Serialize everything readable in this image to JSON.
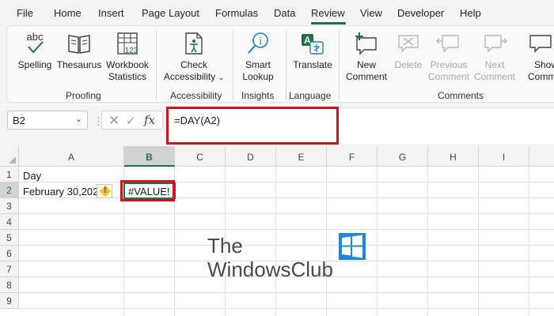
{
  "menu": {
    "tabs": [
      "File",
      "Home",
      "Insert",
      "Page Layout",
      "Formulas",
      "Data",
      "Review",
      "View",
      "Developer",
      "Help"
    ],
    "active_tab": "Review"
  },
  "ribbon": {
    "proofing": {
      "label": "Proofing",
      "spelling_icon_text": "abc",
      "spelling": "Spelling",
      "thesaurus": "Thesaurus",
      "workbook_stats_line1": "Workbook",
      "workbook_stats_line2": "Statistics",
      "stats_icon_text": "123"
    },
    "accessibility": {
      "label": "Accessibility",
      "check_line1": "Check",
      "check_line2": "Accessibility"
    },
    "insights": {
      "label": "Insights",
      "smart_line1": "Smart",
      "smart_line2": "Lookup"
    },
    "language": {
      "label": "Language",
      "translate": "Translate"
    },
    "comments": {
      "label": "Comments",
      "new_line1": "New",
      "new_line2": "Comment",
      "delete": "Delete",
      "previous_line1": "Previous",
      "previous_line2": "Comment",
      "next_line1": "Next",
      "next_line2": "Comment",
      "show_line1": "Show",
      "show_line2": "Comme"
    }
  },
  "formula_bar": {
    "name_box": "B2",
    "formula": "=DAY(A2)"
  },
  "sheet": {
    "columns": [
      "A",
      "B",
      "C",
      "D",
      "E",
      "F",
      "G",
      "H",
      "I"
    ],
    "selected_column": "B",
    "rows": [
      "1",
      "2",
      "3",
      "4",
      "5",
      "6",
      "7",
      "8",
      "9"
    ],
    "selected_row": "2",
    "cells": {
      "A1": "Day",
      "A2": "February 30,202",
      "B2": "#VALUE!"
    }
  },
  "watermark": {
    "line1": "The",
    "line2": "WindowsClub"
  },
  "colors": {
    "accent_green": "#1e7145",
    "highlight_red": "#d0141e"
  }
}
